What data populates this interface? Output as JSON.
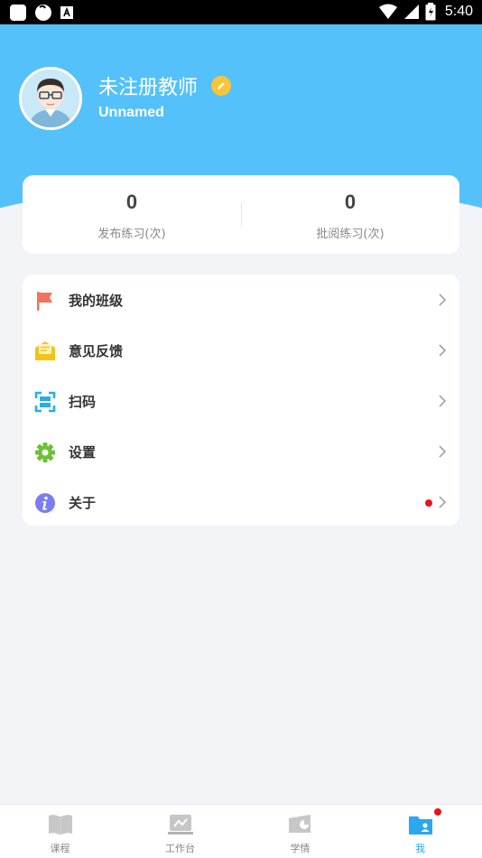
{
  "status_bar": {
    "time": "5:40",
    "icons": [
      "notification-square-icon",
      "app-circle-icon",
      "a-box-icon",
      "wifi-icon",
      "signal-icon",
      "battery-icon"
    ]
  },
  "profile": {
    "name": "未注册教师",
    "subtitle": "Unnamed",
    "avatar": "teacher-avatar",
    "edit_icon": "pencil-icon"
  },
  "stats": [
    {
      "value": "0",
      "label": "发布练习(次)"
    },
    {
      "value": "0",
      "label": "批阅练习(次)"
    }
  ],
  "menu": [
    {
      "label": "我的班级",
      "icon": "flag-icon",
      "color": "#f2745c"
    },
    {
      "label": "意见反馈",
      "icon": "feedback-envelope-icon",
      "color": "#f5c315"
    },
    {
      "label": "扫码",
      "icon": "scan-icon",
      "color": "#27aee8"
    },
    {
      "label": "设置",
      "icon": "gear-icon",
      "color": "#6cc13a"
    },
    {
      "label": "关于",
      "icon": "info-icon",
      "color": "#7b7ef0",
      "has_badge": true
    }
  ],
  "tabs": [
    {
      "label": "课程",
      "icon": "book-icon",
      "active": false
    },
    {
      "label": "工作台",
      "icon": "workbench-icon",
      "active": false
    },
    {
      "label": "学情",
      "icon": "chart-card-icon",
      "active": false
    },
    {
      "label": "我",
      "icon": "profile-folder-icon",
      "active": true,
      "has_badge": true
    }
  ],
  "colors": {
    "header": "#55c1fb",
    "accent": "#2aa8f0",
    "badge": "#e8141a",
    "background": "#f3f4f8"
  }
}
